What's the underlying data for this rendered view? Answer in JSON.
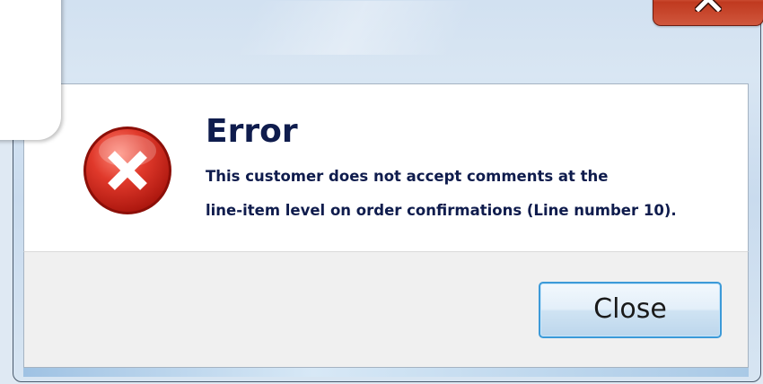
{
  "dialog": {
    "title": "Error",
    "message_lines": [
      "This customer does not accept comments at the",
      "line-item level on order confirmations (Line number 10)."
    ],
    "close_button_label": "Close"
  },
  "icons": {
    "error": "error-x-circle-icon",
    "window_close": "close-icon"
  },
  "colors": {
    "title_text": "#0f1c4d",
    "error_icon_red": "#d9261c",
    "close_button_border": "#3c9ad8",
    "window_close_red": "#c0391f"
  }
}
